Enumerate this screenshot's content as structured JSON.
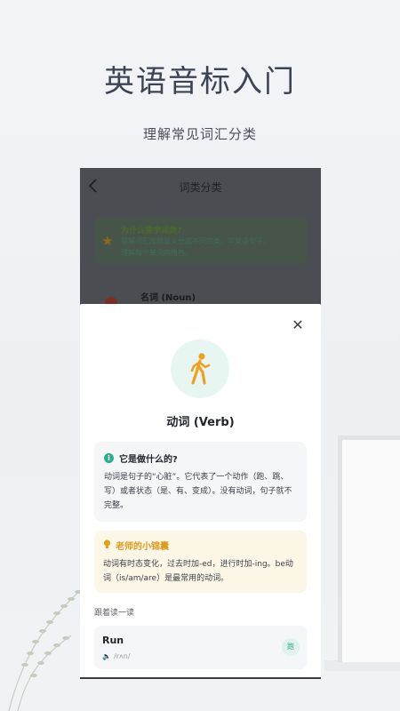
{
  "promo": {
    "title": "英语音标入门",
    "subtitle": "理解常见词汇分类"
  },
  "colors": {
    "accent_green": "#2dab8e",
    "tip_orange": "#e09a1e",
    "icon_orange": "#f0a020",
    "overlay": "#4a4d52"
  },
  "app": {
    "header": {
      "back_icon": "chevron-left-icon",
      "title": "词类分类"
    },
    "why_card": {
      "icon": "star-icon",
      "title": "为什么要学词类?",
      "desc_line1": "理解词汇按照意义分成不同的类，学英语句子，",
      "desc_line2": "理解每个单词的角色。"
    },
    "noun_item": {
      "label": "名词 (Noun)"
    }
  },
  "sheet": {
    "close_icon": "close-icon",
    "word_icon": "walking-person-icon",
    "title": "动词 (Verb)",
    "info": {
      "icon": "info-icon",
      "heading": "它是做什么的?",
      "line1": "动词是句子的“心脏”。它代表了一个动作（跑、跳、",
      "line2": "写）或者状态（是、有、变成）。没有动词，句子就不",
      "line3": "完整。"
    },
    "tip": {
      "icon": "lightbulb-icon",
      "heading": "老师的小锦囊",
      "line1": "动词有时态变化，过去时加-ed，进行时加-ing。be动",
      "line2": "词（is/am/are）是最常用的动词。"
    },
    "read_along_label": "跟着读一读",
    "example": {
      "word": "Run",
      "speaker_icon": "speaker-icon",
      "phonetic": "/rʌn/",
      "chinese": "跑"
    }
  }
}
